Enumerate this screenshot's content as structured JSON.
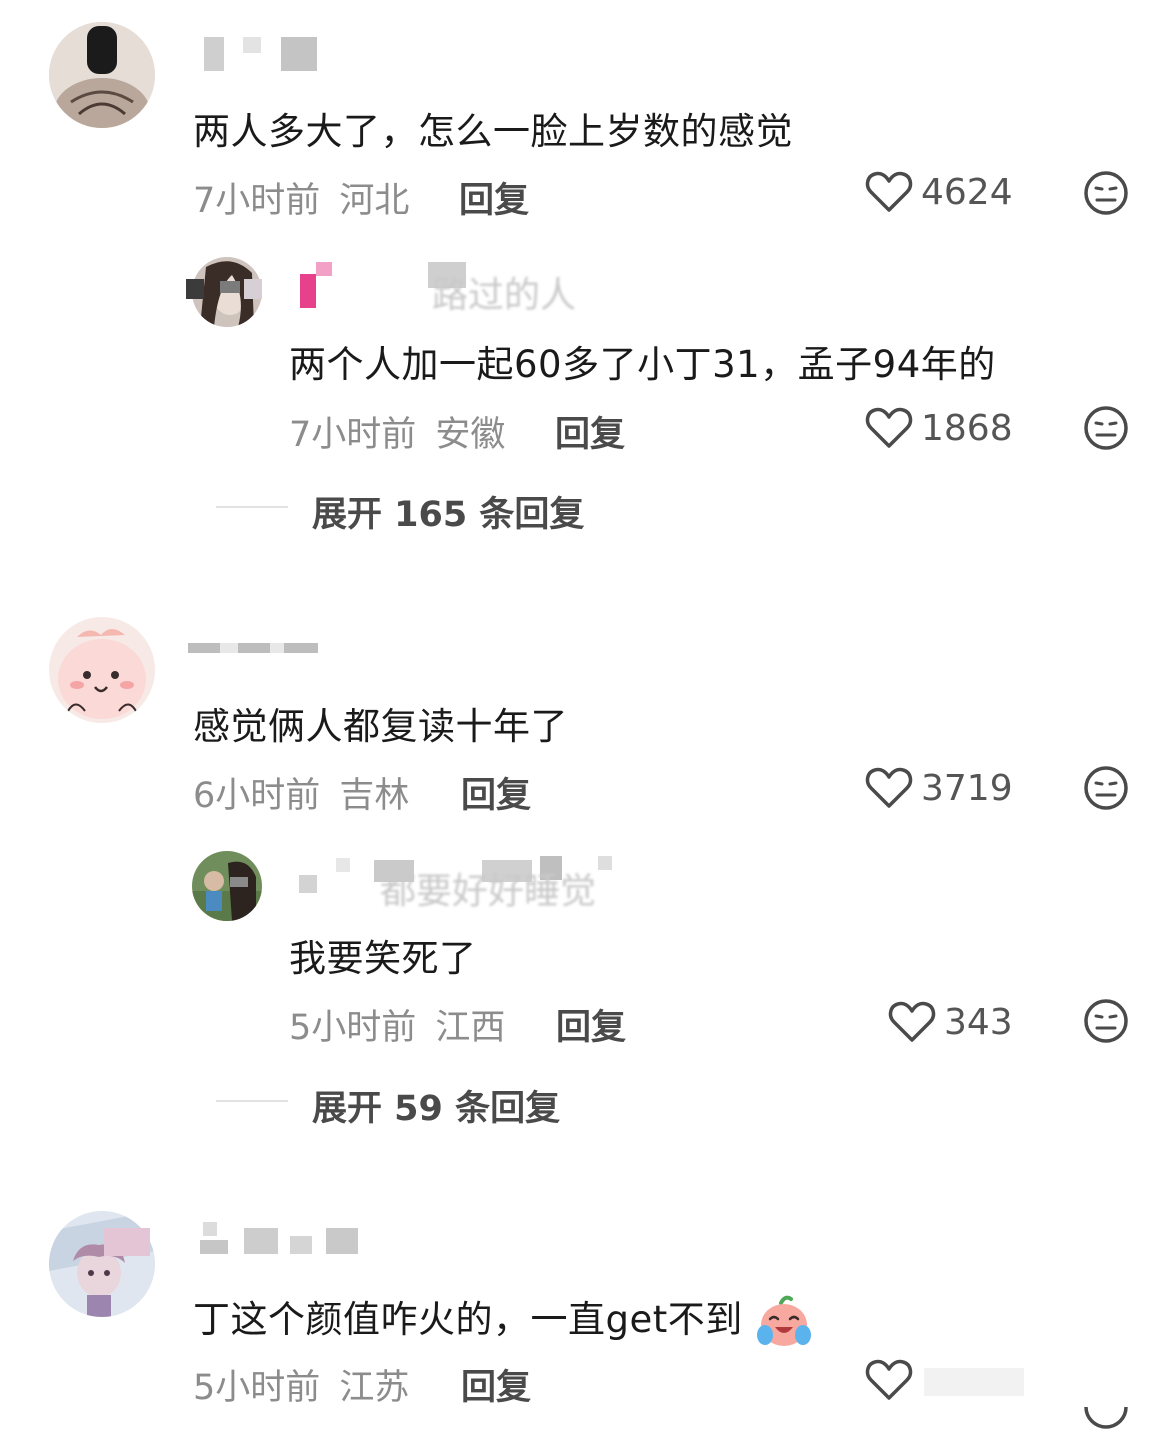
{
  "comments": [
    {
      "text": "两人多大了，怎么一脸上岁数的感觉",
      "time": "7小时前",
      "location": "河北",
      "reply_label": "回复",
      "likes": "4624",
      "replies": [
        {
          "name_fragment": "路过的人",
          "text": "两个人加一起60多了小丁31，孟子94年的",
          "time": "7小时前",
          "location": "安徽",
          "reply_label": "回复",
          "likes": "1868"
        }
      ],
      "expand_label": "展开 165 条回复"
    },
    {
      "text": "感觉俩人都复读十年了",
      "time": "6小时前",
      "location": "吉林",
      "reply_label": "回复",
      "likes": "3719",
      "replies": [
        {
          "name_fragment": "都要好好睡觉",
          "text": "我要笑死了",
          "time": "5小时前",
          "location": "江西",
          "reply_label": "回复",
          "likes": "343"
        }
      ],
      "expand_label": "展开 59 条回复"
    },
    {
      "text": "丁这个颜值咋火的，一直get不到",
      "time": "5小时前",
      "location": "江苏",
      "reply_label": "回复",
      "likes": ""
    }
  ],
  "icons": {
    "like": "heart-outline-icon",
    "dislike": "meh-face-icon",
    "inline_emoji": "crying-laughing-peach-emoji"
  },
  "colors": {
    "meta_gray": "#8c8c8c",
    "icon_gray": "#4a4a4a",
    "emoji_pink": "#f7a9a0",
    "emoji_blue": "#5ab3ec"
  }
}
